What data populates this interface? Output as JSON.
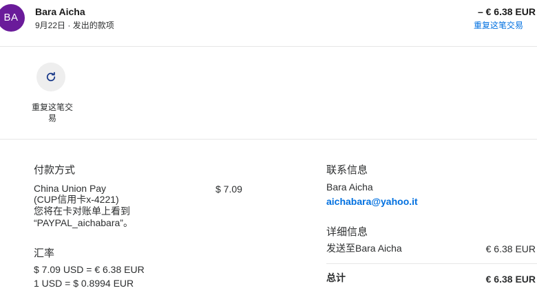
{
  "header": {
    "avatar_initials": "BA",
    "avatar_color": "#6a1b9a",
    "name": "Bara Aicha",
    "date": "9月22日",
    "separator": "·",
    "type": "发出的款项",
    "amount": "– € 6.38 EUR",
    "repeat_link": "重复这笔交易",
    "link_color": "#0070e0"
  },
  "actions": {
    "repeat_icon": "refresh-icon",
    "repeat_label": "重复这笔交易"
  },
  "payment": {
    "title": "付款方式",
    "method_line1": "China Union Pay",
    "method_line2": "(CUP信用卡x-4221)",
    "note_line1": "您将在卡对账单上看到",
    "note_line2": "“PAYPAL_aichabara”。",
    "amount": "$ 7.09"
  },
  "exchange": {
    "title": "汇率",
    "line1": "$ 7.09 USD = € 6.38 EUR",
    "line2": "1 USD = $ 0.8994 EUR"
  },
  "contact": {
    "title": "联系信息",
    "name": "Bara Aicha",
    "email": "aichabara@yahoo.it"
  },
  "detail": {
    "title": "详细信息",
    "sent_to_label": "发送至Bara Aicha",
    "sent_to_amount": "€ 6.38 EUR",
    "total_label": "总计",
    "total_amount": "€ 6.38 EUR"
  }
}
